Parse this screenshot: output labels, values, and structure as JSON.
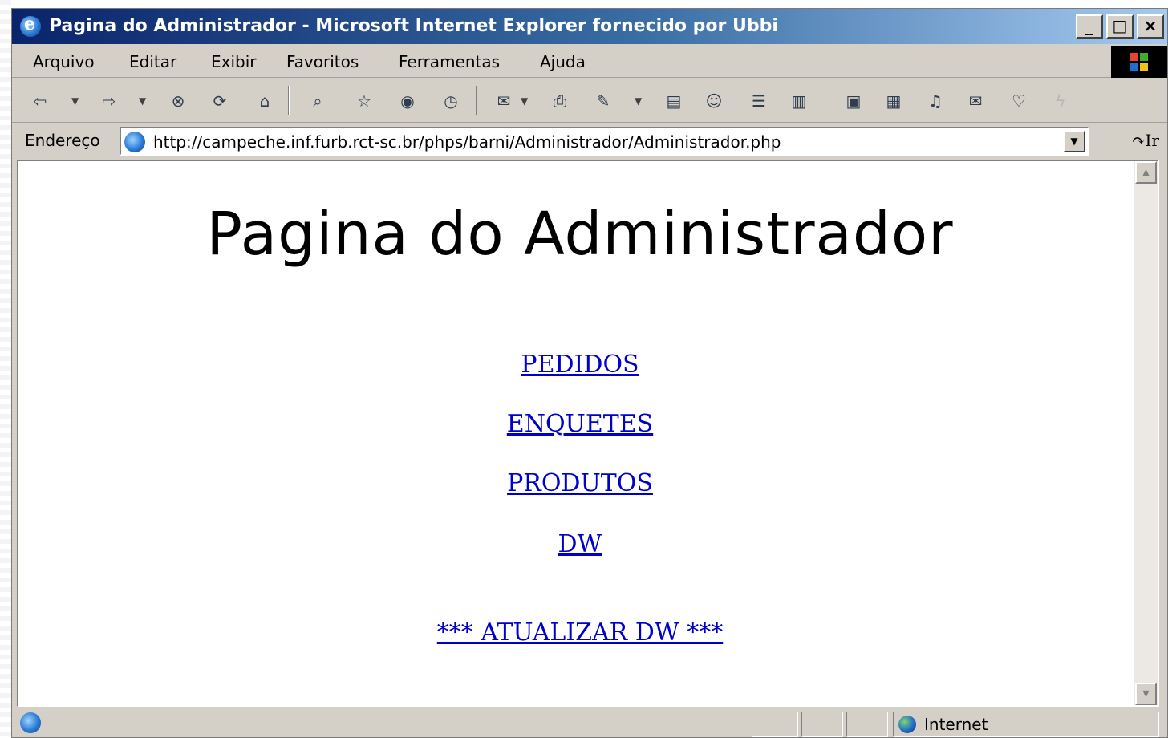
{
  "window": {
    "title": "Pagina do Administrador - Microsoft Internet Explorer fornecido por Ubbi",
    "controls": [
      "_",
      "□",
      "×"
    ]
  },
  "menubar": {
    "items": [
      "Arquivo",
      "Editar",
      "Exibir",
      "Favoritos",
      "Ferramentas",
      "Ajuda"
    ]
  },
  "toolbar": {
    "icons": {
      "back": "⇦",
      "forward": "⇨",
      "stop": "⊗",
      "refresh": "⟳",
      "home": "⌂",
      "search": "⌕",
      "favorites": "☆",
      "media": "◉",
      "history": "◷",
      "mail": "✉",
      "print": "⎙",
      "edit": "✎",
      "discuss": "▤",
      "messenger": "☺",
      "research": "☰",
      "chart": "▥",
      "doc": "▣",
      "frame": "▦",
      "speaker": "♫",
      "envelope": "✉",
      "heart": "♡",
      "flash": "ϟ"
    }
  },
  "addressbar": {
    "label": "Endereço",
    "url": "http://campeche.inf.furb.rct-sc.br/phps/barni/Administrador/Administrador.php",
    "go_label": "Ir",
    "go_icon": "↷"
  },
  "page": {
    "title": "Pagina do Administrador",
    "links": [
      "PEDIDOS",
      "ENQUETES",
      "PRODUTOS",
      "DW"
    ],
    "update_link": "*** ATUALIZAR DW ***"
  },
  "statusbar": {
    "zone": "Internet"
  }
}
